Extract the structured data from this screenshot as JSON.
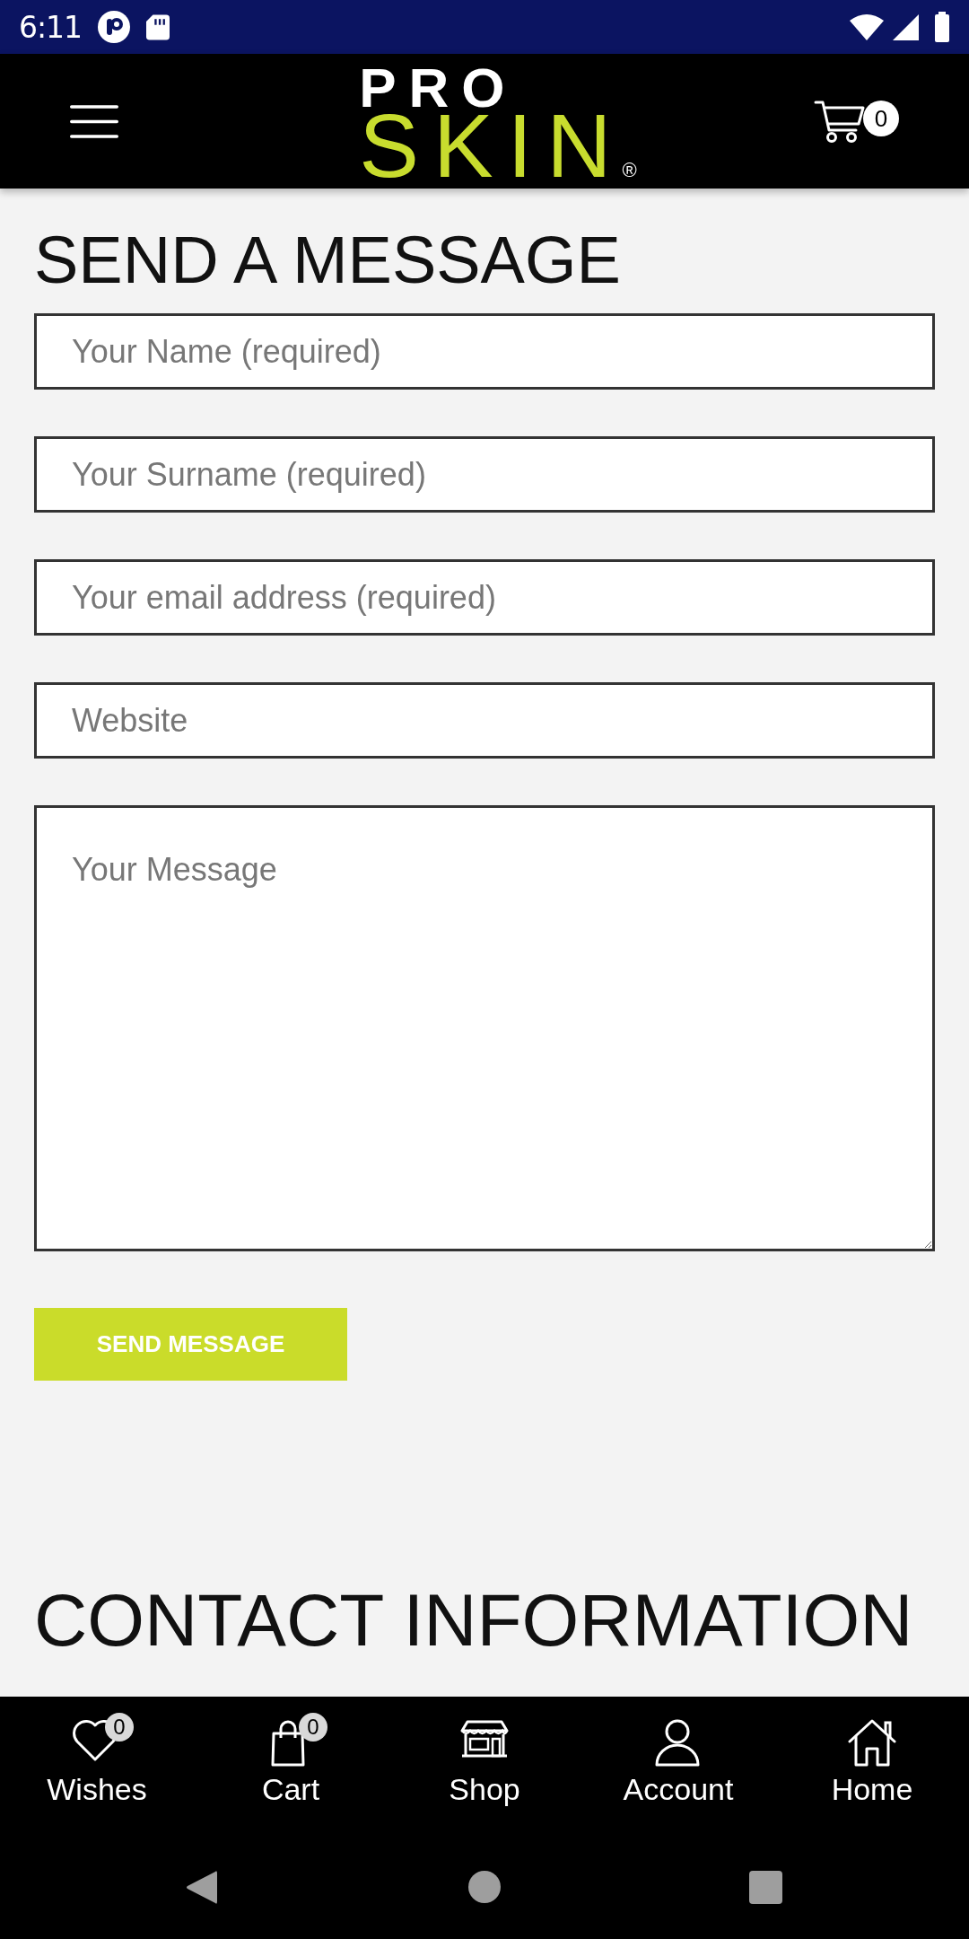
{
  "status_bar": {
    "time": "6:11"
  },
  "header": {
    "logo": {
      "line_1": "PRO",
      "line_2": "SKIN",
      "mark": "®"
    },
    "cart_count": "0"
  },
  "form": {
    "title": "SEND A MESSAGE",
    "fields": [
      {
        "kind": "input",
        "placeholder": "Your Name (required)"
      },
      {
        "kind": "input",
        "placeholder": "Your Surname (required)"
      },
      {
        "kind": "input",
        "placeholder": "Your email address (required)"
      },
      {
        "kind": "input",
        "placeholder": "Website"
      },
      {
        "kind": "textarea",
        "placeholder": "Your Message"
      }
    ],
    "submit": "SEND MESSAGE"
  },
  "contact": {
    "title": "CONTACT INFORMATION"
  },
  "bottom_nav": [
    {
      "label": "Wishes",
      "badge": "0"
    },
    {
      "label": "Cart",
      "badge": "0"
    },
    {
      "label": "Shop"
    },
    {
      "label": "Account"
    },
    {
      "label": "Home"
    }
  ]
}
